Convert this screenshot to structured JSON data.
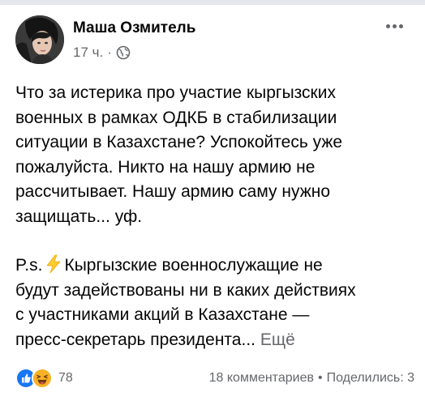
{
  "post": {
    "author": "Маша Озмитель",
    "time": "17 ч.",
    "separator": "·",
    "privacy_icon": "globe-icon",
    "more_icon": "more-options-icon",
    "text_lines": [
      "Что за истерика про участие кыргызских",
      "военных в рамках ОДКБ в стабилизации",
      "ситуации в Казахстане? Успокойтесь уже",
      "пожалуйста. Никто на нашу армию не",
      "рассчитывает. Нашу армию саму нужно",
      "защищать... уф."
    ],
    "ps_lines": {
      "line1_before_icon": "P.s.",
      "line1_after_icon": "Кыргызские военнослужащие не",
      "line2": "будут задействованы ни в каких действиях",
      "line3": "с участниками акций в Казахстане —",
      "line4_text": "пресс-секретарь президента",
      "ellipsis": "...",
      "more_label": "Ещё"
    },
    "ps_icon": "high-voltage-icon"
  },
  "footer": {
    "reaction_icons": [
      "like-icon",
      "haha-icon"
    ],
    "reaction_count": "78",
    "comments": "18 комментариев",
    "dot": "•",
    "shares": "Поделились: 3"
  },
  "colors": {
    "text": "#050505",
    "secondary": "#65676b",
    "like_blue": "#1877f2",
    "haha_yellow": "#f7b125",
    "bolt_yellow": "#ffcc33"
  }
}
